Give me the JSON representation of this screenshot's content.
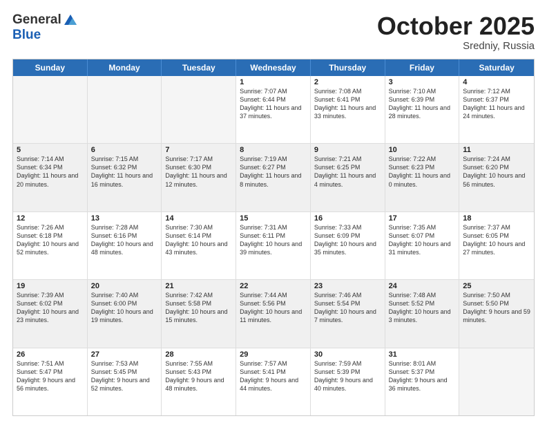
{
  "header": {
    "logo": {
      "general": "General",
      "blue": "Blue",
      "tagline": ""
    },
    "title": "October 2025",
    "subtitle": "Sredniy, Russia"
  },
  "days_of_week": [
    "Sunday",
    "Monday",
    "Tuesday",
    "Wednesday",
    "Thursday",
    "Friday",
    "Saturday"
  ],
  "weeks": [
    [
      {
        "day": "",
        "text": "",
        "empty": true
      },
      {
        "day": "",
        "text": "",
        "empty": true
      },
      {
        "day": "",
        "text": "",
        "empty": true
      },
      {
        "day": "1",
        "text": "Sunrise: 7:07 AM\nSunset: 6:44 PM\nDaylight: 11 hours and 37 minutes."
      },
      {
        "day": "2",
        "text": "Sunrise: 7:08 AM\nSunset: 6:41 PM\nDaylight: 11 hours and 33 minutes."
      },
      {
        "day": "3",
        "text": "Sunrise: 7:10 AM\nSunset: 6:39 PM\nDaylight: 11 hours and 28 minutes."
      },
      {
        "day": "4",
        "text": "Sunrise: 7:12 AM\nSunset: 6:37 PM\nDaylight: 11 hours and 24 minutes."
      }
    ],
    [
      {
        "day": "5",
        "text": "Sunrise: 7:14 AM\nSunset: 6:34 PM\nDaylight: 11 hours and 20 minutes.",
        "shaded": true
      },
      {
        "day": "6",
        "text": "Sunrise: 7:15 AM\nSunset: 6:32 PM\nDaylight: 11 hours and 16 minutes.",
        "shaded": true
      },
      {
        "day": "7",
        "text": "Sunrise: 7:17 AM\nSunset: 6:30 PM\nDaylight: 11 hours and 12 minutes.",
        "shaded": true
      },
      {
        "day": "8",
        "text": "Sunrise: 7:19 AM\nSunset: 6:27 PM\nDaylight: 11 hours and 8 minutes.",
        "shaded": true
      },
      {
        "day": "9",
        "text": "Sunrise: 7:21 AM\nSunset: 6:25 PM\nDaylight: 11 hours and 4 minutes.",
        "shaded": true
      },
      {
        "day": "10",
        "text": "Sunrise: 7:22 AM\nSunset: 6:23 PM\nDaylight: 11 hours and 0 minutes.",
        "shaded": true
      },
      {
        "day": "11",
        "text": "Sunrise: 7:24 AM\nSunset: 6:20 PM\nDaylight: 10 hours and 56 minutes.",
        "shaded": true
      }
    ],
    [
      {
        "day": "12",
        "text": "Sunrise: 7:26 AM\nSunset: 6:18 PM\nDaylight: 10 hours and 52 minutes."
      },
      {
        "day": "13",
        "text": "Sunrise: 7:28 AM\nSunset: 6:16 PM\nDaylight: 10 hours and 48 minutes."
      },
      {
        "day": "14",
        "text": "Sunrise: 7:30 AM\nSunset: 6:14 PM\nDaylight: 10 hours and 43 minutes."
      },
      {
        "day": "15",
        "text": "Sunrise: 7:31 AM\nSunset: 6:11 PM\nDaylight: 10 hours and 39 minutes."
      },
      {
        "day": "16",
        "text": "Sunrise: 7:33 AM\nSunset: 6:09 PM\nDaylight: 10 hours and 35 minutes."
      },
      {
        "day": "17",
        "text": "Sunrise: 7:35 AM\nSunset: 6:07 PM\nDaylight: 10 hours and 31 minutes."
      },
      {
        "day": "18",
        "text": "Sunrise: 7:37 AM\nSunset: 6:05 PM\nDaylight: 10 hours and 27 minutes."
      }
    ],
    [
      {
        "day": "19",
        "text": "Sunrise: 7:39 AM\nSunset: 6:02 PM\nDaylight: 10 hours and 23 minutes.",
        "shaded": true
      },
      {
        "day": "20",
        "text": "Sunrise: 7:40 AM\nSunset: 6:00 PM\nDaylight: 10 hours and 19 minutes.",
        "shaded": true
      },
      {
        "day": "21",
        "text": "Sunrise: 7:42 AM\nSunset: 5:58 PM\nDaylight: 10 hours and 15 minutes.",
        "shaded": true
      },
      {
        "day": "22",
        "text": "Sunrise: 7:44 AM\nSunset: 5:56 PM\nDaylight: 10 hours and 11 minutes.",
        "shaded": true
      },
      {
        "day": "23",
        "text": "Sunrise: 7:46 AM\nSunset: 5:54 PM\nDaylight: 10 hours and 7 minutes.",
        "shaded": true
      },
      {
        "day": "24",
        "text": "Sunrise: 7:48 AM\nSunset: 5:52 PM\nDaylight: 10 hours and 3 minutes.",
        "shaded": true
      },
      {
        "day": "25",
        "text": "Sunrise: 7:50 AM\nSunset: 5:50 PM\nDaylight: 9 hours and 59 minutes.",
        "shaded": true
      }
    ],
    [
      {
        "day": "26",
        "text": "Sunrise: 7:51 AM\nSunset: 5:47 PM\nDaylight: 9 hours and 56 minutes."
      },
      {
        "day": "27",
        "text": "Sunrise: 7:53 AM\nSunset: 5:45 PM\nDaylight: 9 hours and 52 minutes."
      },
      {
        "day": "28",
        "text": "Sunrise: 7:55 AM\nSunset: 5:43 PM\nDaylight: 9 hours and 48 minutes."
      },
      {
        "day": "29",
        "text": "Sunrise: 7:57 AM\nSunset: 5:41 PM\nDaylight: 9 hours and 44 minutes."
      },
      {
        "day": "30",
        "text": "Sunrise: 7:59 AM\nSunset: 5:39 PM\nDaylight: 9 hours and 40 minutes."
      },
      {
        "day": "31",
        "text": "Sunrise: 8:01 AM\nSunset: 5:37 PM\nDaylight: 9 hours and 36 minutes."
      },
      {
        "day": "",
        "text": "",
        "empty": true
      }
    ]
  ]
}
